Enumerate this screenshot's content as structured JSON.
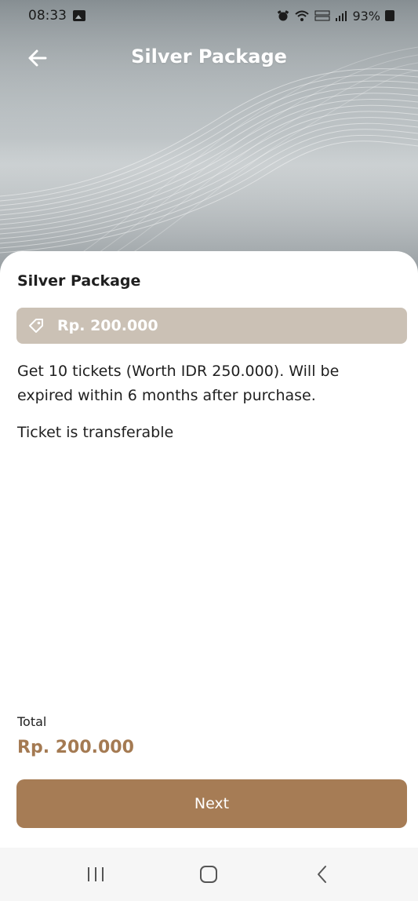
{
  "status_bar": {
    "time": "08:33",
    "battery_text": "93%",
    "icons": [
      "image-icon",
      "alarm-icon",
      "wifi-icon",
      "lte-icon",
      "signal-icon",
      "battery-icon"
    ]
  },
  "header": {
    "title": "Silver Package",
    "back_icon": "arrow-left-icon"
  },
  "package": {
    "name": "Silver Package",
    "price": "Rp. 200.000",
    "price_icon": "tag-icon",
    "description": "Get 10 tickets (Worth IDR 250.000). Will be expired within 6 months after purchase.",
    "note": "Ticket is transferable"
  },
  "summary": {
    "total_label": "Total",
    "total_amount": "Rp. 200.000"
  },
  "actions": {
    "next_label": "Next"
  },
  "nav": {
    "icons": [
      "recent-apps-icon",
      "home-icon",
      "back-nav-icon"
    ]
  },
  "colors": {
    "accent": "#a67c55",
    "price_tag_bg": "#cbc1b5",
    "total_text": "#a47a52"
  }
}
